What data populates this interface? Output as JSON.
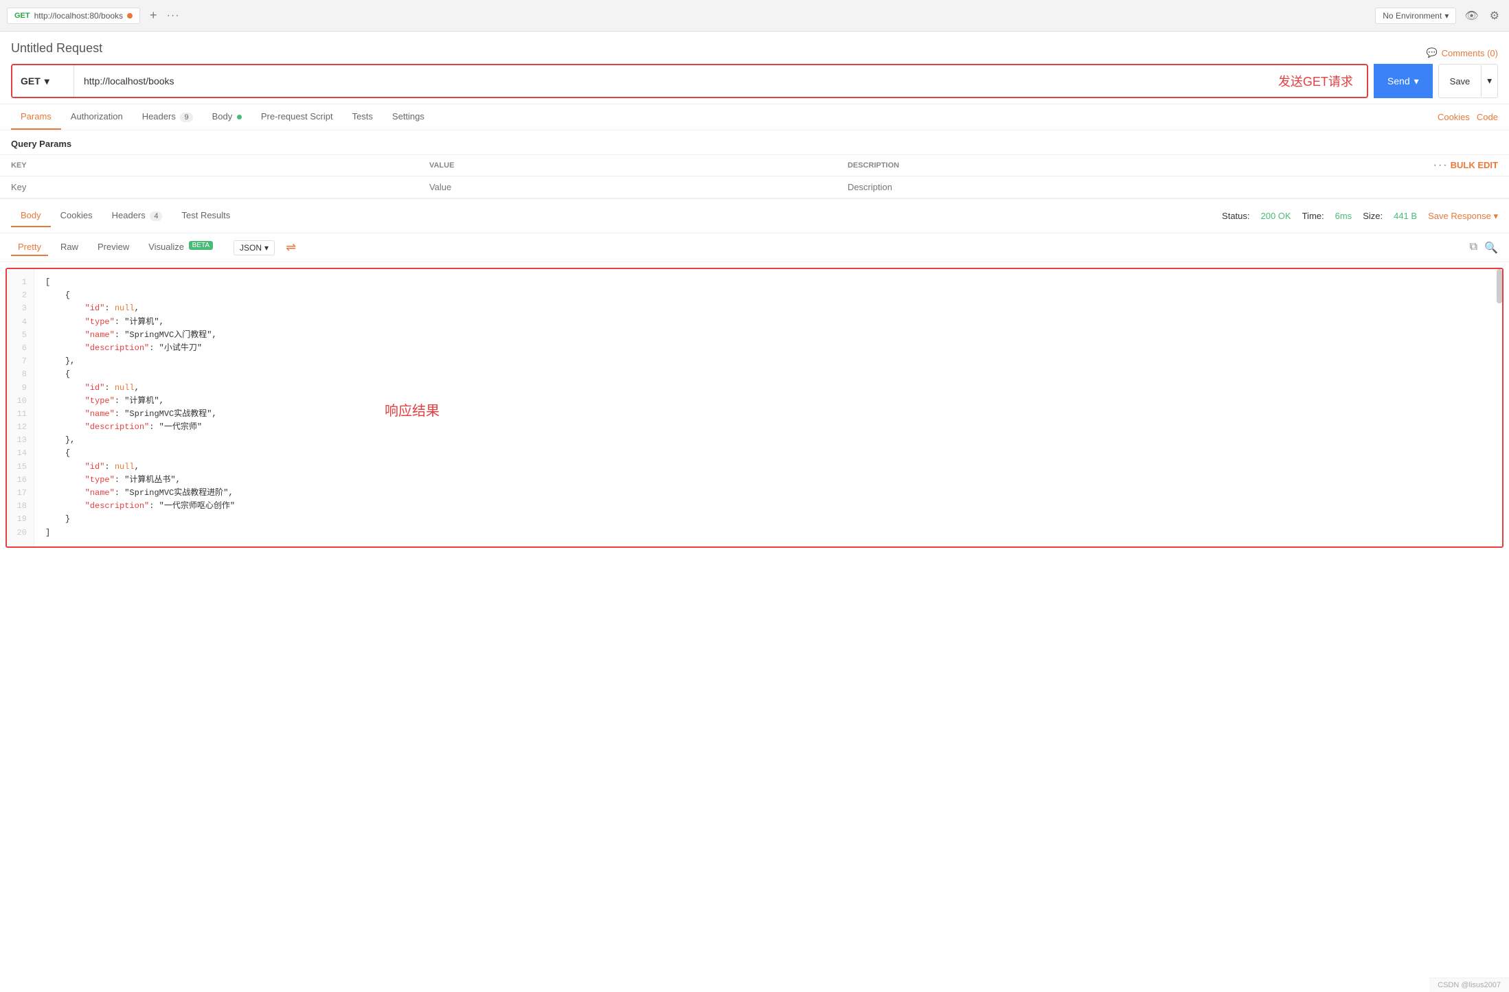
{
  "topbar": {
    "method": "GET",
    "url": "http://localhost:80/books",
    "dot_color": "#e8793a",
    "env_label": "No Environment",
    "comments_label": "Comments (0)"
  },
  "request": {
    "title": "Untitled Request",
    "method": "GET",
    "url_value": "http://localhost/books",
    "annotation": "发送GET请求",
    "send_label": "Send",
    "save_label": "Save"
  },
  "tabs": {
    "items": [
      {
        "label": "Params",
        "active": true,
        "badge": null
      },
      {
        "label": "Authorization",
        "active": false,
        "badge": null
      },
      {
        "label": "Headers",
        "active": false,
        "badge": "9"
      },
      {
        "label": "Body",
        "active": false,
        "badge": null,
        "dot": true
      },
      {
        "label": "Pre-request Script",
        "active": false,
        "badge": null
      },
      {
        "label": "Tests",
        "active": false,
        "badge": null
      },
      {
        "label": "Settings",
        "active": false,
        "badge": null
      }
    ],
    "right": [
      {
        "label": "Cookies"
      },
      {
        "label": "Code"
      }
    ]
  },
  "query_params": {
    "title": "Query Params",
    "columns": [
      "KEY",
      "VALUE",
      "DESCRIPTION"
    ],
    "key_placeholder": "Key",
    "value_placeholder": "Value",
    "desc_placeholder": "Description"
  },
  "response": {
    "tabs": [
      {
        "label": "Body",
        "active": true
      },
      {
        "label": "Cookies",
        "active": false
      },
      {
        "label": "Headers",
        "active": false,
        "badge": "4"
      },
      {
        "label": "Test Results",
        "active": false
      }
    ],
    "status_label": "Status:",
    "status_value": "200 OK",
    "time_label": "Time:",
    "time_value": "6ms",
    "size_label": "Size:",
    "size_value": "441 B",
    "save_response": "Save Response"
  },
  "format_bar": {
    "tabs": [
      "Pretty",
      "Raw",
      "Preview",
      "Visualize"
    ],
    "active": "Pretty",
    "visualize_beta": "BETA",
    "format": "JSON"
  },
  "code": {
    "annotation": "响应结果",
    "lines": [
      {
        "num": 1,
        "text": "["
      },
      {
        "num": 2,
        "text": "    {"
      },
      {
        "num": 3,
        "text": "        \"id\": null,"
      },
      {
        "num": 4,
        "text": "        \"type\": \"计算机\","
      },
      {
        "num": 5,
        "text": "        \"name\": \"SpringMVC入门教程\","
      },
      {
        "num": 6,
        "text": "        \"description\": \"小试牛刀\""
      },
      {
        "num": 7,
        "text": "    },"
      },
      {
        "num": 8,
        "text": "    {"
      },
      {
        "num": 9,
        "text": "        \"id\": null,"
      },
      {
        "num": 10,
        "text": "        \"type\": \"计算机\","
      },
      {
        "num": 11,
        "text": "        \"name\": \"SpringMVC实战教程\","
      },
      {
        "num": 12,
        "text": "        \"description\": \"一代宗师\""
      },
      {
        "num": 13,
        "text": "    },"
      },
      {
        "num": 14,
        "text": "    {"
      },
      {
        "num": 15,
        "text": "        \"id\": null,"
      },
      {
        "num": 16,
        "text": "        \"type\": \"计算机丛书\","
      },
      {
        "num": 17,
        "text": "        \"name\": \"SpringMVC实战教程进阶\","
      },
      {
        "num": 18,
        "text": "        \"description\": \"一代宗师呕心创作\""
      },
      {
        "num": 19,
        "text": "    }"
      },
      {
        "num": 20,
        "text": "]"
      }
    ]
  },
  "footer": {
    "text": "CSDN @lisus2007"
  }
}
